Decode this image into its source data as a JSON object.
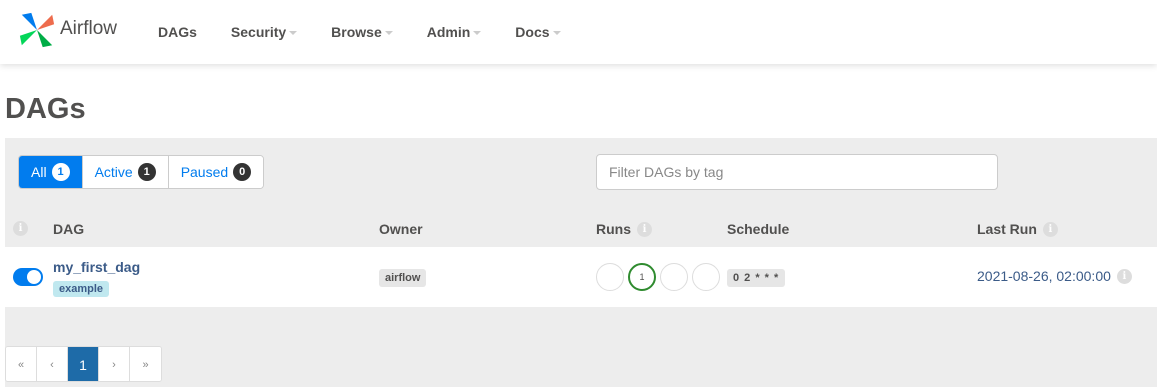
{
  "app": {
    "name": "Airflow"
  },
  "nav": {
    "items": [
      {
        "label": "DAGs",
        "dropdown": false
      },
      {
        "label": "Security",
        "dropdown": true
      },
      {
        "label": "Browse",
        "dropdown": true
      },
      {
        "label": "Admin",
        "dropdown": true
      },
      {
        "label": "Docs",
        "dropdown": true
      }
    ]
  },
  "page": {
    "title": "DAGs"
  },
  "filters": {
    "all": {
      "label": "All",
      "count": "1",
      "active": true
    },
    "active": {
      "label": "Active",
      "count": "1"
    },
    "paused": {
      "label": "Paused",
      "count": "0"
    },
    "tag_placeholder": "Filter DAGs by tag"
  },
  "table": {
    "headers": {
      "dag": "DAG",
      "owner": "Owner",
      "runs": "Runs",
      "schedule": "Schedule",
      "last_run": "Last Run"
    },
    "rows": [
      {
        "dag_id": "my_first_dag",
        "tag": "example",
        "enabled": true,
        "owner": "airflow",
        "runs": [
          "",
          "1",
          "",
          ""
        ],
        "schedule": "0 2 * * *",
        "last_run": "2021-08-26, 02:00:00"
      }
    ]
  },
  "pagination": {
    "first": "«",
    "prev": "‹",
    "current": "1",
    "next": "›",
    "last": "»"
  },
  "colors": {
    "primary": "#017cee",
    "success": "#2f8b2f",
    "link": "#3b5b88"
  }
}
